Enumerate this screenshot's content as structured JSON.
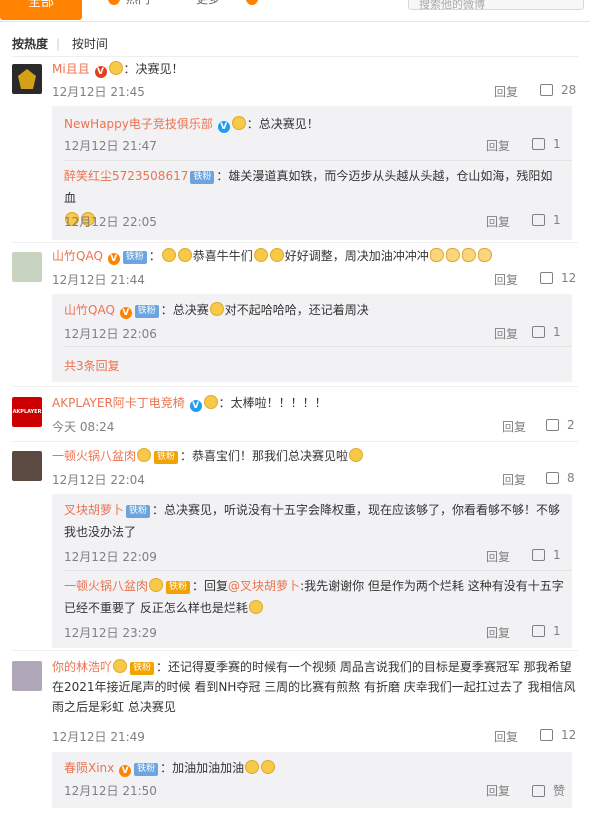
{
  "tabs": {
    "active": "全部",
    "hot": "热门",
    "more": "更多",
    "search_placeholder": "搜索他的微博"
  },
  "sort": {
    "hot": "按热度",
    "time": "按时间"
  },
  "like_icon": "thumbs-up-icon",
  "comments": [
    {
      "user": "Mi且且",
      "text": "：决赛见！",
      "time": "12月12日 21:45",
      "reply_label": "回复",
      "likes": "28"
    },
    {
      "user": "山竹QAQ",
      "text": "恭喜牛牛们",
      "text2": "好好调整，周决加油冲冲冲",
      "time": "12月12日 21:44",
      "reply_label": "回复",
      "likes": "12"
    },
    {
      "user": "AKPLAYER阿卡丁电竞椅",
      "text": "：太棒啦！！！！！",
      "time": "今天 08:24",
      "reply_label": "回复",
      "likes": "2"
    },
    {
      "user": "一顿火锅八盆肉",
      "text": "：恭喜宝们！那我们总决赛见啦",
      "time": "12月12日 22:04",
      "reply_label": "回复",
      "likes": "8"
    },
    {
      "user": "你的林浩吖",
      "text": "：还记得夏季赛的时候有一个视频 周品言说我们的目标是夏季赛冠军 那我希望在2021年接近尾声的时候 看到NH夺冠 三周的比赛有煎熬 有折磨 庆幸我们一起扛过去了 我相信风雨之后是彩虹 总决赛见",
      "time": "12月12日 21:49",
      "reply_label": "回复",
      "likes": "12"
    }
  ],
  "replies": [
    {
      "user": "NewHappy电子竞技俱乐部",
      "text": "：总决赛见！",
      "time": "12月12日 21:47",
      "reply_label": "回复",
      "likes": "1"
    },
    {
      "user": "醉笑红尘5723508617",
      "badge": "铁粉",
      "text": "：雄关漫道真如铁，而今迈步从头越从头越，仓山如海，残阳如血",
      "time": "12月12日 22:05",
      "reply_label": "回复",
      "likes": "1"
    },
    {
      "user": "山竹QAQ",
      "badge": "铁粉",
      "text": "：总决赛",
      "text2": "对不起哈哈哈，还记着周决",
      "time": "12月12日 22:06",
      "reply_label": "回复",
      "likes": "1"
    },
    {
      "user": "叉块胡萝卜",
      "badge": "铁粉",
      "text": "：总决赛见，听说没有十五字会降权重，现在应该够了，你看看够不够！不够我也没办法了",
      "time": "12月12日 22:09",
      "reply_label": "回复",
      "likes": "1"
    },
    {
      "user": "一顿火锅八盆肉",
      "badge": "铁粉",
      "text": "：回复",
      "mention": "@叉块胡萝卜",
      "text2": ":我先谢谢你 但是作为两个烂耗 这种有没有十五字已经不重要了 反正怎么样也是烂耗",
      "time": "12月12日 23:29",
      "reply_label": "回复",
      "likes": "1"
    },
    {
      "user": "春陨Xinx",
      "badge": "铁粉",
      "text": "：加油加油加油",
      "time": "12月12日 21:50",
      "reply_label": "回复",
      "likes": "赞"
    }
  ],
  "more_replies": "共3条回复",
  "badges": {
    "iron": "铁粉"
  },
  "colors": {
    "accent": "#ff8200",
    "name": "#eb7350",
    "reply_bg": "#f2f2f5"
  }
}
